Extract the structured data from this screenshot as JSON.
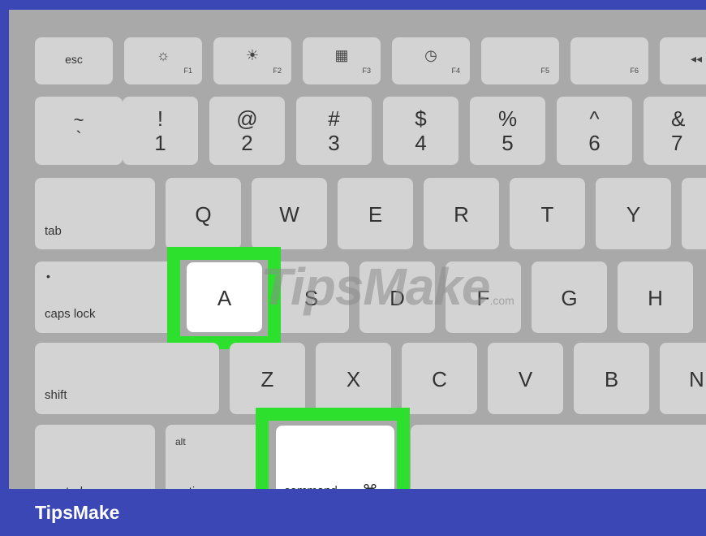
{
  "keyboard": {
    "function_row": [
      {
        "label": "esc",
        "fn": ""
      },
      {
        "icon": "brightness-down-icon",
        "glyph": "☼",
        "fn": "F1"
      },
      {
        "icon": "brightness-up-icon",
        "glyph": "☀",
        "fn": "F2"
      },
      {
        "icon": "mission-control-icon",
        "glyph": "▦",
        "fn": "F3"
      },
      {
        "icon": "dashboard-icon",
        "glyph": "◷",
        "fn": "F4"
      },
      {
        "icon": "",
        "glyph": "",
        "fn": "F5"
      },
      {
        "icon": "",
        "glyph": "",
        "fn": "F6"
      },
      {
        "icon": "rewind-icon",
        "glyph": "◂◂",
        "fn": ""
      }
    ],
    "number_row": [
      {
        "top": "~",
        "bottom": "`"
      },
      {
        "top": "!",
        "bottom": "1"
      },
      {
        "top": "@",
        "bottom": "2"
      },
      {
        "top": "#",
        "bottom": "3"
      },
      {
        "top": "$",
        "bottom": "4"
      },
      {
        "top": "%",
        "bottom": "5"
      },
      {
        "top": "^",
        "bottom": "6"
      },
      {
        "top": "&",
        "bottom": "7"
      }
    ],
    "qwerty_row": {
      "tab": "tab",
      "keys": [
        "Q",
        "W",
        "E",
        "R",
        "T",
        "Y"
      ]
    },
    "home_row": {
      "caps_dot": "•",
      "caps": "caps lock",
      "keys": [
        "A",
        "S",
        "D",
        "F",
        "G",
        "H"
      ]
    },
    "shift_row": {
      "shift": "shift",
      "keys": [
        "Z",
        "X",
        "C",
        "V",
        "B",
        "N"
      ]
    },
    "bottom_row": {
      "control": "control",
      "alt": "alt",
      "option": "option",
      "command": "command",
      "command_symbol": "⌘"
    },
    "highlighted": [
      "A",
      "command"
    ]
  },
  "watermark": {
    "text": "TipsMake",
    "suffix": ".com"
  },
  "footer": {
    "brand": "TipsMake"
  },
  "colors": {
    "border": "#3b47b5",
    "highlight": "#2de02d",
    "key": "#d3d3d3",
    "keyboard_bg": "#a9a9a9"
  }
}
